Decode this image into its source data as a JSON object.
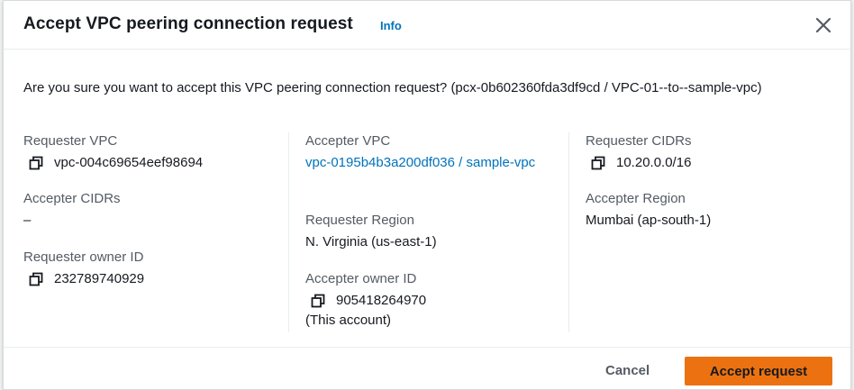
{
  "modal": {
    "title": "Accept VPC peering connection request",
    "info_label": "Info",
    "question": "Are you sure you want to accept this VPC peering connection request? (pcx-0b602360fda3df9cd / VPC-01--to--sample-vpc)"
  },
  "details": {
    "requester_vpc": {
      "label": "Requester VPC",
      "value": "vpc-004c69654eef98694"
    },
    "accepter_cidrs": {
      "label": "Accepter CIDRs",
      "value": "–"
    },
    "requester_owner_id": {
      "label": "Requester owner ID",
      "value": "232789740929"
    },
    "accepter_vpc": {
      "label": "Accepter VPC",
      "value": "vpc-0195b4b3a200df036 / sample-vpc"
    },
    "requester_region": {
      "label": "Requester Region",
      "value": "N. Virginia (us-east-1)"
    },
    "accepter_owner_id": {
      "label": "Accepter owner ID",
      "value": "905418264970",
      "note": "(This account)"
    },
    "requester_cidrs": {
      "label": "Requester CIDRs",
      "value": "10.20.0.0/16"
    },
    "accepter_region": {
      "label": "Accepter Region",
      "value": "Mumbai (ap-south-1)"
    }
  },
  "footer": {
    "cancel_label": "Cancel",
    "accept_label": "Accept request"
  },
  "colors": {
    "accent": "#ec7211",
    "link": "#0073bb",
    "label": "#545b64",
    "text": "#16191f"
  },
  "icons": [
    "close-icon",
    "copy-icon"
  ]
}
